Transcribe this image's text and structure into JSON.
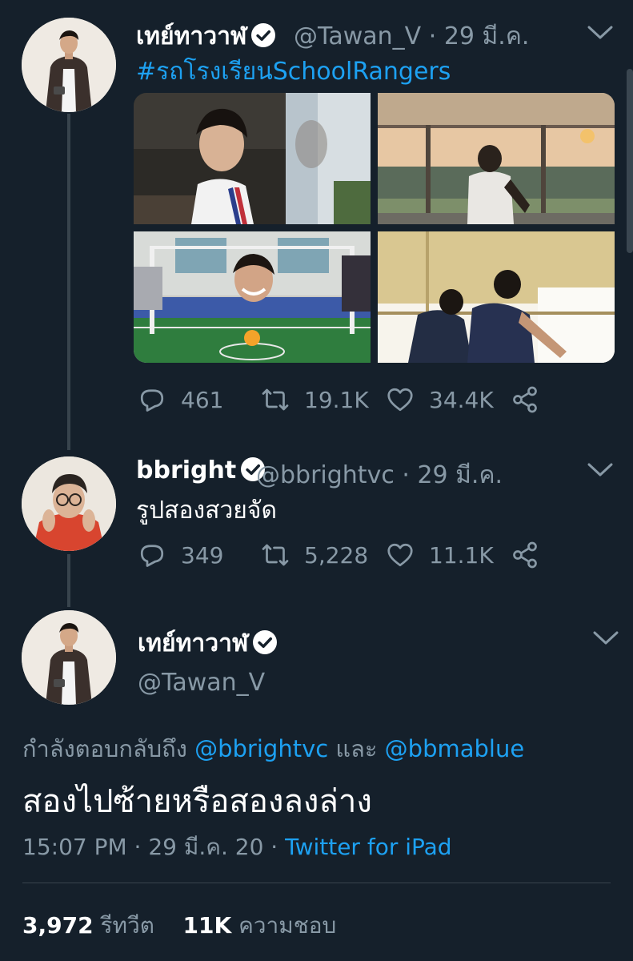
{
  "colors": {
    "background": "#15202b",
    "accent": "#1da1f2",
    "muted": "#8899a6",
    "divider": "#38444d"
  },
  "tweet1": {
    "name": "เทย์ทาวาฬ",
    "handle": "@Tawan_V",
    "date": "· 29 มี.ค.",
    "hashtag": "#รถโรงเรียนSchoolRangers",
    "media": [
      {
        "icon": "photo-classroom"
      },
      {
        "icon": "photo-window-sunset"
      },
      {
        "icon": "photo-soccer-table"
      },
      {
        "icon": "photo-two-men-window"
      }
    ],
    "replies": "461",
    "retweets": "19.1K",
    "likes": "34.4K"
  },
  "tweet2": {
    "name": "bbright",
    "handle": "@bbrightvc",
    "date": "· 29 มี.ค.",
    "text": "รูปสองสวยจัด",
    "replies": "349",
    "retweets": "5,228",
    "likes": "11.1K"
  },
  "focus": {
    "name": "เทย์ทาวาฬ",
    "handle": "@Tawan_V",
    "reply_prefix": "กำลังตอบกลับถึง",
    "mention1": "@bbrightvc",
    "conjunction": "และ",
    "mention2": "@bbmablue",
    "text": "สองไปซ้ายหรือสองลงล่าง",
    "time": "15:07 PM · 29 มี.ค. 20 ·",
    "source": "Twitter for iPad",
    "retweet_count": "3,972",
    "retweet_label": "รีทวีต",
    "like_count": "11K",
    "like_label": "ความชอบ"
  }
}
